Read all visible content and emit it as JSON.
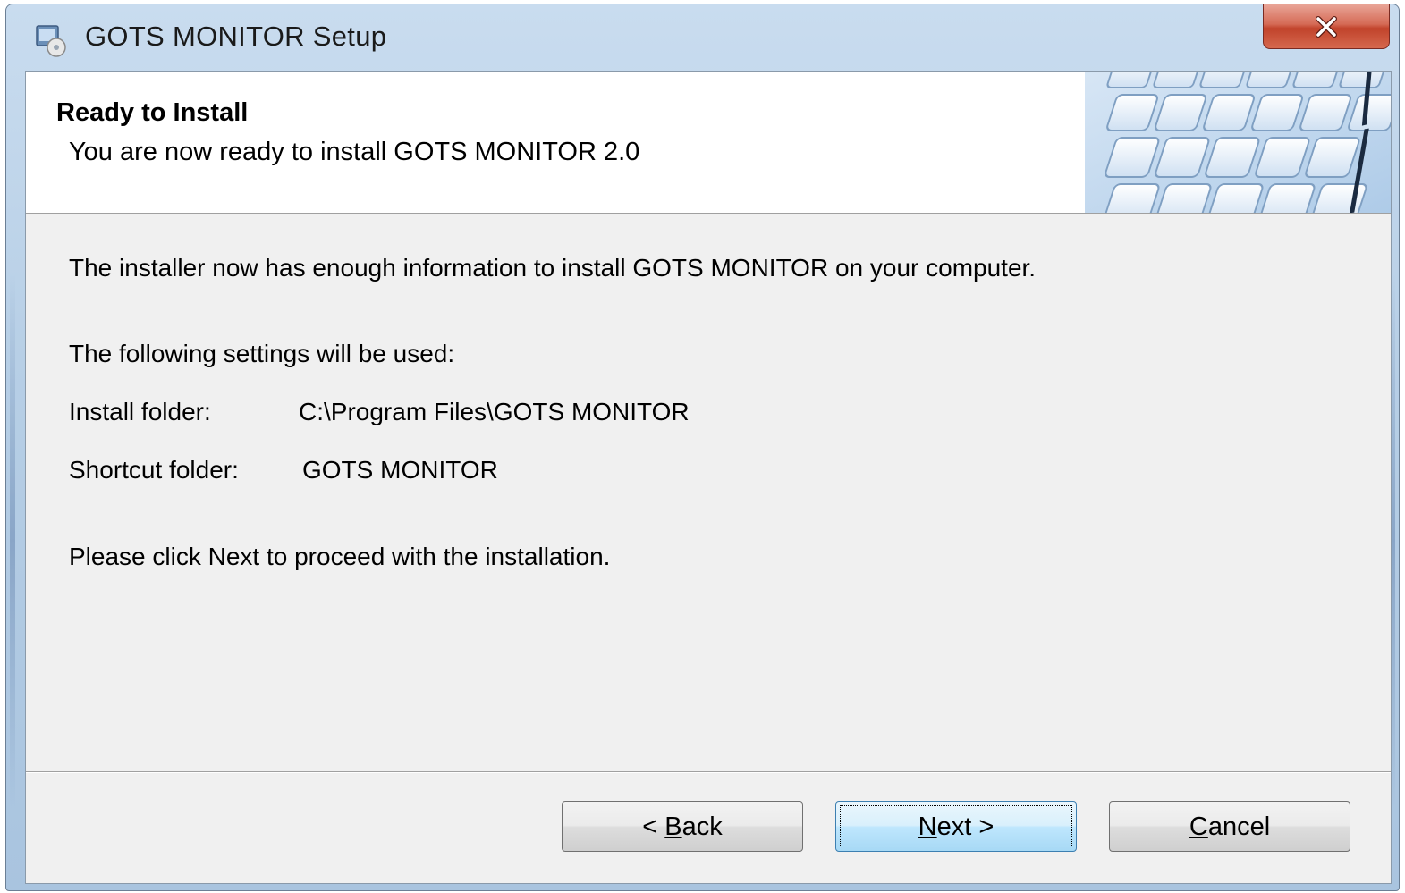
{
  "window": {
    "title": "GOTS MONITOR Setup",
    "close_label": "X"
  },
  "header": {
    "title": "Ready to Install",
    "subtitle": "You are now ready to install GOTS MONITOR 2.0"
  },
  "body": {
    "intro": "The installer now has enough information to install GOTS MONITOR on your computer.",
    "settings_heading": "The following settings will be used:",
    "settings": [
      {
        "label": "Install folder:",
        "value": "C:\\Program Files\\GOTS MONITOR"
      },
      {
        "label": "Shortcut folder:",
        "value": "GOTS MONITOR"
      }
    ],
    "instruction": "Please click Next to proceed with the installation."
  },
  "buttons": {
    "back": {
      "prefix": "< ",
      "mnemonic": "B",
      "rest": "ack"
    },
    "next": {
      "mnemonic": "N",
      "rest": "ext >"
    },
    "cancel": {
      "mnemonic": "C",
      "rest": "ancel"
    }
  },
  "icons": {
    "app": "installer-icon",
    "header_art": "keyboard-keys-graphic",
    "close": "close-icon"
  },
  "colors": {
    "titlebar": "#b7cfe6",
    "close_button": "#c1432b",
    "client_bg": "#f0f0f0",
    "default_button": "#bee6fd"
  }
}
